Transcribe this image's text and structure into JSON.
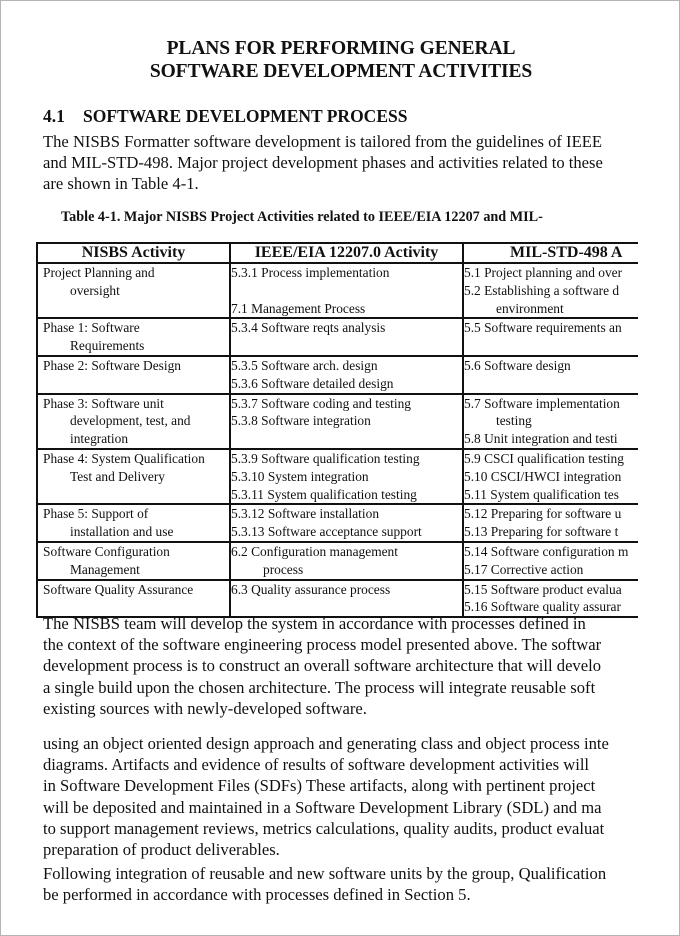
{
  "document": {
    "title_line1": "PLANS FOR PERFORMING GENERAL",
    "title_line2": "SOFTWARE DEVELOPMENT ACTIVITIES",
    "section_number": "4.1",
    "section_title": "SOFTWARE DEVELOPMENT PROCESS",
    "intro_lines": [
      "The NISBS Formatter software development is tailored from the guidelines of IEEE",
      "and MIL-STD-498. Major project development phases and activities related to these",
      "are shown in Table 4-1."
    ],
    "table_caption": "Table 4-1.  Major NISBS Project Activities related to IEEE/EIA 12207 and MIL-",
    "table": {
      "headers": [
        "NISBS Activity",
        "IEEE/EIA 12207.0 Activity",
        "MIL-STD-498 A"
      ],
      "rows": [
        {
          "activity": [
            "Project Planning and",
            "oversight"
          ],
          "ieee": [
            "5.3.1 Process implementation",
            "",
            "7.1 Management Process"
          ],
          "mil": [
            "5.1 Project planning and over",
            "5.2 Establishing a software d",
            "environment"
          ]
        },
        {
          "activity": [
            "Phase 1: Software",
            "Requirements"
          ],
          "ieee": [
            "5.3.4 Software reqts analysis"
          ],
          "mil": [
            "5.5 Software requirements an"
          ]
        },
        {
          "activity": [
            "Phase 2: Software Design"
          ],
          "ieee": [
            "5.3.5 Software arch. design",
            "5.3.6 Software detailed design"
          ],
          "mil": [
            "5.6 Software design"
          ]
        },
        {
          "activity": [
            "Phase 3: Software unit",
            "development, test, and",
            "integration"
          ],
          "ieee": [
            "5.3.7 Software coding and testing",
            "5.3.8 Software integration"
          ],
          "mil": [
            "5.7 Software implementation",
            "testing",
            "5.8 Unit integration and testi"
          ]
        },
        {
          "activity": [
            "Phase 4: System Qualification",
            "Test and Delivery"
          ],
          "ieee": [
            "5.3.9 Software qualification testing",
            "5.3.10 System integration",
            "5.3.11 System qualification testing"
          ],
          "mil": [
            "5.9 CSCI qualification testing",
            "5.10 CSCI/HWCI integration",
            "5.11 System qualification tes"
          ]
        },
        {
          "activity": [
            "Phase 5: Support of",
            "installation and use"
          ],
          "ieee": [
            "5.3.12 Software installation",
            "5.3.13 Software acceptance support"
          ],
          "mil": [
            "5.12 Preparing for software u",
            "5.13 Preparing for software t"
          ]
        },
        {
          "activity": [
            "Software Configuration",
            "Management"
          ],
          "ieee": [
            "6.2 Configuration management",
            "process"
          ],
          "mil": [
            "5.14 Software configuration m",
            "5.17 Corrective action"
          ]
        },
        {
          "activity": [
            "Software Quality Assurance"
          ],
          "ieee": [
            "6.3 Quality assurance process"
          ],
          "mil": [
            "5.15 Software product evalua",
            "5.16 Software quality assurar"
          ]
        }
      ]
    },
    "para2_lines": [
      "The NISBS team will develop the system in accordance with processes defined in",
      "the context of the software engineering process model presented above.  The softwar",
      "development process is to construct an overall software architecture that will develo",
      "a single build upon the chosen architecture.  The process will integrate reusable soft",
      "existing sources with newly-developed software."
    ],
    "para3_lines": [
      "using an object oriented design approach and generating class and object process inte",
      "diagrams.  Artifacts and evidence of results of software development activities will",
      "in Software Development Files (SDFs) These artifacts, along with pertinent project",
      "will be deposited and maintained in a Software Development Library (SDL) and ma",
      "to support management reviews, metrics calculations, quality audits, product evaluat",
      "preparation of product deliverables."
    ],
    "para4_lines": [
      "Following integration of reusable and new software units by the group, Qualification",
      "be performed in accordance with processes defined in Section 5."
    ]
  }
}
